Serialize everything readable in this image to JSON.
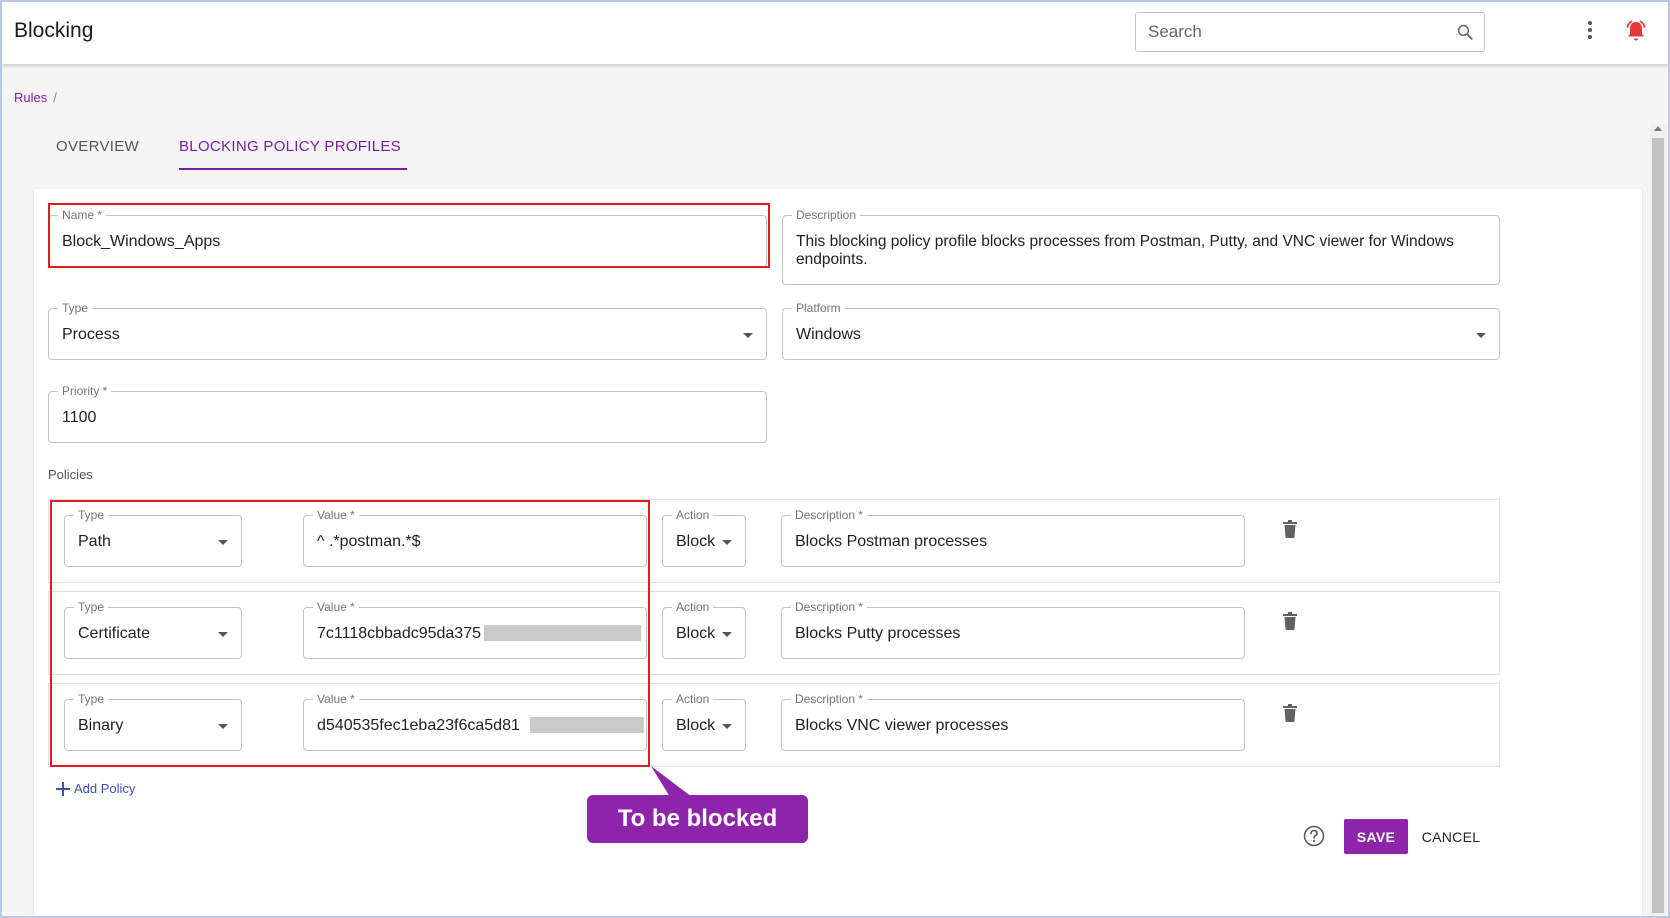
{
  "header": {
    "title": "Blocking",
    "search_placeholder": "Search",
    "icons": [
      "search-icon",
      "more-vert-icon",
      "bell-alert-icon"
    ],
    "accent_color": "#e53935"
  },
  "breadcrumb": {
    "items": [
      "Rules"
    ],
    "separator": "/"
  },
  "tabs": [
    {
      "label": "OVERVIEW",
      "active": false
    },
    {
      "label": "BLOCKING POLICY PROFILES",
      "active": true
    }
  ],
  "form": {
    "name": {
      "label": "Name *",
      "value": "Block_Windows_Apps"
    },
    "description": {
      "label": "Description",
      "value": "This blocking policy profile blocks processes from Postman, Putty, and VNC viewer for Windows endpoints."
    },
    "type": {
      "label": "Type",
      "value": "Process"
    },
    "platform": {
      "label": "Platform",
      "value": "Windows"
    },
    "priority": {
      "label": "Priority *",
      "value": "1100"
    },
    "policies_label": "Policies"
  },
  "policies": [
    {
      "type_label": "Type",
      "type": "Path",
      "value_label": "Value *",
      "value": "^ .*postman.*$",
      "action_label": "Action",
      "action": "Block",
      "description_label": "Description *",
      "description": "Blocks Postman processes"
    },
    {
      "type_label": "Type",
      "type": "Certificate",
      "value_label": "Value *",
      "value": "7c1118cbbadc95da375",
      "action_label": "Action",
      "action": "Block",
      "description_label": "Description *",
      "description": "Blocks Putty processes"
    },
    {
      "type_label": "Type",
      "type": "Binary",
      "value_label": "Value *",
      "value": "d540535fec1eba23f6ca5d81",
      "action_label": "Action",
      "action": "Block",
      "description_label": "Description *",
      "description": "Blocks VNC viewer processes"
    }
  ],
  "add_policy_label": "Add Policy",
  "callout_text": "To be blocked",
  "footer": {
    "save_label": "SAVE",
    "cancel_label": "CANCEL"
  },
  "colors": {
    "primary": "#8e24aa",
    "highlight": "#e01b24",
    "link": "#3b52b4"
  }
}
